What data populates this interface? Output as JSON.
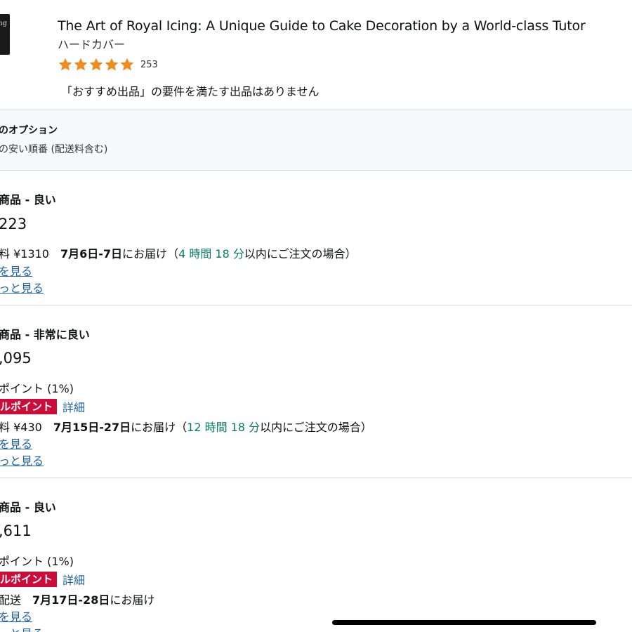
{
  "product": {
    "thumbnail_text": "ing",
    "title": "The Art of Royal Icing: A Unique Guide to Cake Decoration by a World-class Tutor",
    "binding": "ハードカバー",
    "rating_stars": 5,
    "rating_count": "253",
    "no_recommended_offer": "「おすすめ出品」の要件を満たす出品はありません"
  },
  "options": {
    "title": "のオプション",
    "sort": "の安い順番 (配送料含む)"
  },
  "colors": {
    "star": "#f08c1e",
    "badge": "#cc0c39",
    "link": "#2162a1",
    "timer": "#067d62"
  },
  "offers": [
    {
      "condition": "商品 - 良い",
      "price": "223",
      "delivery_fee": "料 ¥1310",
      "delivery_date": "7月6日-7日",
      "delivery_suffix": "にお届け（",
      "timer": "4 時間 18 分",
      "timer_suffix": "以内にご注文の場合）",
      "link1": "を見る",
      "link2": "っと見る"
    },
    {
      "condition": "商品 - 非常に良い",
      "price": ",095",
      "points": "ポイント (1%)",
      "badge": "ルポイント",
      "detail_link": "詳細",
      "delivery_fee": "料 ¥430",
      "delivery_date": "7月15日-27日",
      "delivery_suffix": "にお届け（",
      "timer": "12 時間 18 分",
      "timer_suffix": "以内にご注文の場合）",
      "link1": "を見る",
      "link2": "っと見る"
    },
    {
      "condition": "商品 - 良い",
      "price": ",611",
      "points": "ポイント (1%)",
      "badge": "ルポイント",
      "detail_link": "詳細",
      "delivery_fee": "配送",
      "delivery_date": "7月17日-28日",
      "delivery_suffix": "にお届け",
      "link1": "を見る",
      "link2": "っと見る"
    }
  ]
}
